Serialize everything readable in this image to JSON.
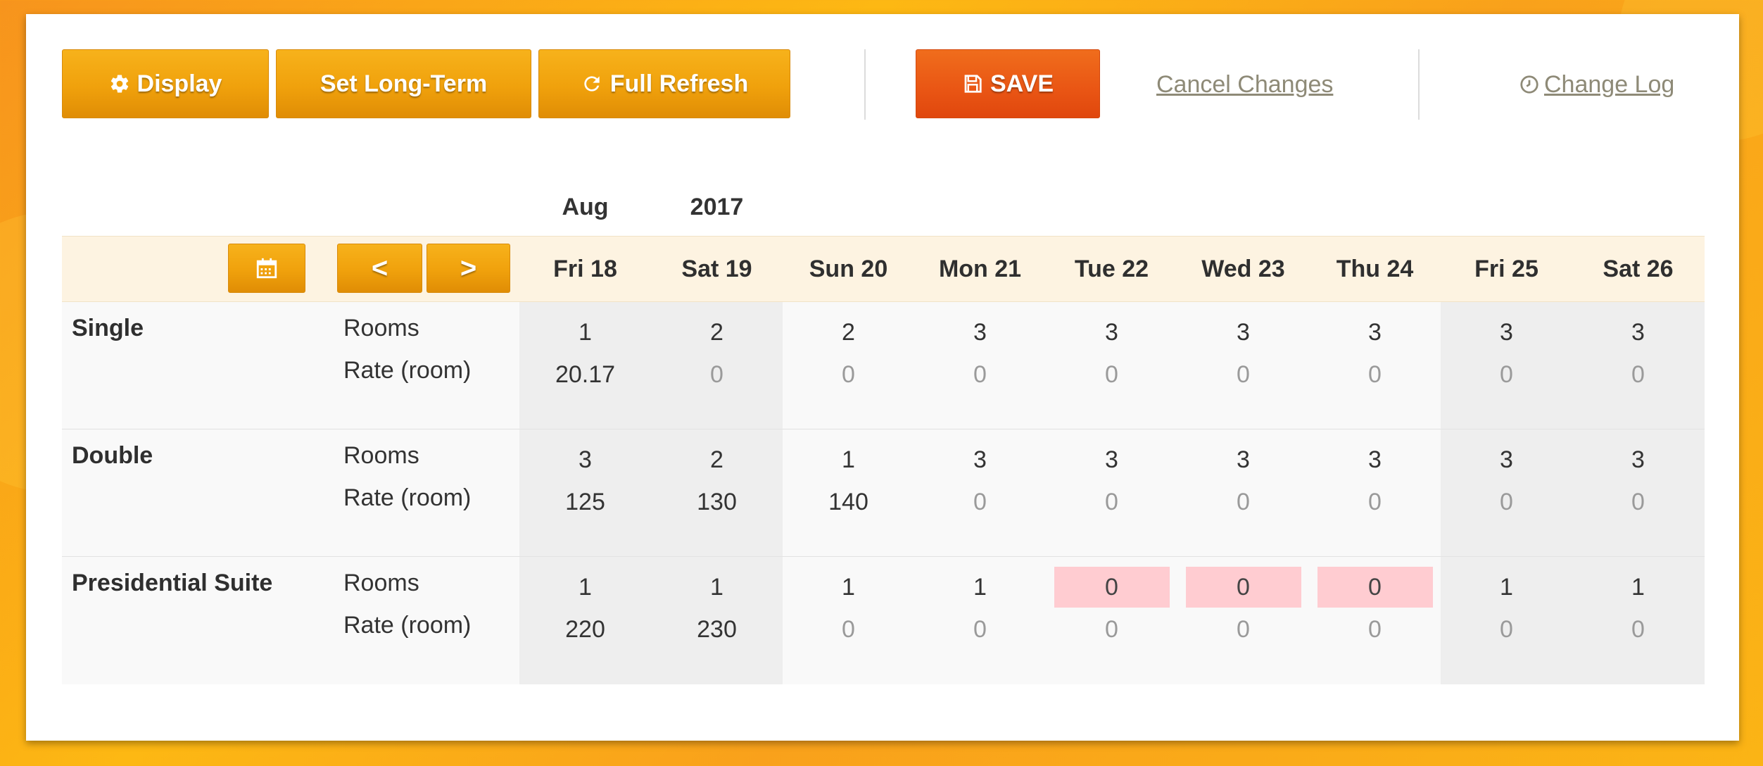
{
  "toolbar": {
    "display_label": "Display",
    "long_term_label": "Set Long-Term",
    "refresh_label": "Full Refresh",
    "save_label": "SAVE",
    "cancel_label": "Cancel Changes",
    "changelog_label": "Change Log"
  },
  "calendar": {
    "month": "Aug",
    "year": "2017",
    "prev_label": "<",
    "next_label": ">",
    "days": [
      "Fri 18",
      "Sat 19",
      "Sun 20",
      "Mon 21",
      "Tue 22",
      "Wed 23",
      "Thu 24",
      "Fri 25",
      "Sat 26"
    ]
  },
  "row_labels": {
    "rooms": "Rooms",
    "rate": "Rate (room)"
  },
  "room_types": [
    {
      "name": "Single",
      "rooms": [
        "1",
        "2",
        "2",
        "3",
        "3",
        "3",
        "3",
        "3",
        "3"
      ],
      "rates": [
        "20.17",
        "0",
        "0",
        "0",
        "0",
        "0",
        "0",
        "0",
        "0"
      ]
    },
    {
      "name": "Double",
      "rooms": [
        "3",
        "2",
        "1",
        "3",
        "3",
        "3",
        "3",
        "3",
        "3"
      ],
      "rates": [
        "125",
        "130",
        "140",
        "0",
        "0",
        "0",
        "0",
        "0",
        "0"
      ]
    },
    {
      "name": "Presidential Suite",
      "rooms": [
        "1",
        "1",
        "1",
        "1",
        "0",
        "0",
        "0",
        "1",
        "1"
      ],
      "rates": [
        "220",
        "230",
        "0",
        "0",
        "0",
        "0",
        "0",
        "0",
        "0"
      ]
    }
  ],
  "colors": {
    "accent_orange": "#f0a10c",
    "save_red": "#e95514",
    "zero_inventory_highlight": "#ffccd1"
  }
}
